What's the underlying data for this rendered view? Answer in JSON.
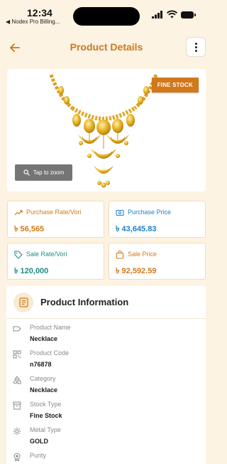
{
  "status_bar": {
    "time": "12:34",
    "back_app": "◀ Nodex Pro Billing..."
  },
  "header": {
    "title": "Product Details"
  },
  "image_card": {
    "badge": "FINE STOCK",
    "zoom_label": "Tap to zoom"
  },
  "stats": [
    {
      "label": "Purchase Rate/Vori",
      "value": "৳ 56,565",
      "color": "#d07a1c"
    },
    {
      "label": "Purchase Price",
      "value": "৳ 43,645.83",
      "color": "#1b82c9"
    },
    {
      "label": "Sale Rate/Vori",
      "value": "৳ 120,000",
      "color": "#218c84"
    },
    {
      "label": "Sale Price",
      "value": "৳ 92,592.59",
      "color": "#d07a1c"
    }
  ],
  "product_info": {
    "title": "Product Information",
    "fields": [
      {
        "label": "Product Name",
        "value": "Necklace"
      },
      {
        "label": "Product Code",
        "value": "n76878"
      },
      {
        "label": "Category",
        "value": "Necklace"
      },
      {
        "label": "Stock Type",
        "value": "Fine Stock"
      },
      {
        "label": "Metal Type",
        "value": "GOLD"
      },
      {
        "label": "Purity",
        "value": ""
      }
    ]
  },
  "colors": {
    "accent": "#c9791b",
    "badge": "#d0781a",
    "background": "#fdf3e3"
  }
}
